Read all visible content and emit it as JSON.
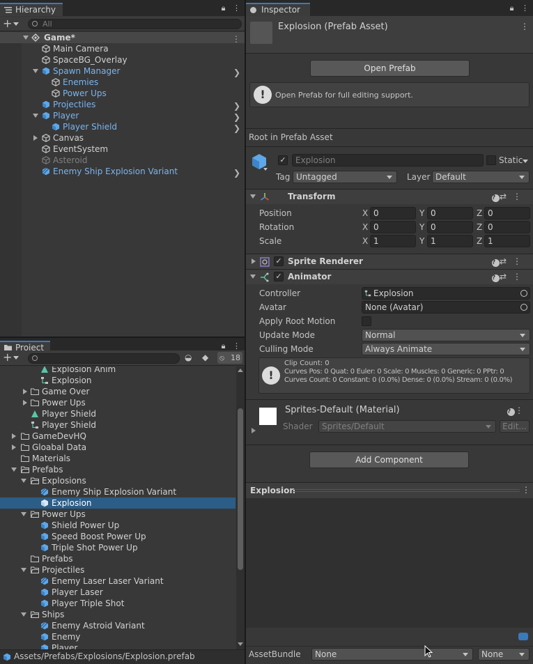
{
  "hierarchy": {
    "tab_label": "Hierarchy",
    "search_placeholder": "All",
    "scene_name": "Game*",
    "items": [
      {
        "label": "Main Camera"
      },
      {
        "label": "SpaceBG_Overlay"
      },
      {
        "label": "Spawn Manager"
      },
      {
        "label": "Enemies"
      },
      {
        "label": "Power Ups"
      },
      {
        "label": "Projectiles"
      },
      {
        "label": "Player"
      },
      {
        "label": "Player Shield"
      },
      {
        "label": "Canvas"
      },
      {
        "label": "EventSystem"
      },
      {
        "label": "Asteroid"
      },
      {
        "label": "Enemy Ship Explosion Variant"
      }
    ]
  },
  "project": {
    "tab_label": "Project",
    "hidden_count": "18",
    "items": [
      {
        "label": "Explosion Anim"
      },
      {
        "label": "Explosion"
      },
      {
        "label": "Game Over"
      },
      {
        "label": "Power Ups"
      },
      {
        "label": "Player Shield"
      },
      {
        "label": "Player Shield"
      },
      {
        "label": "GameDevHQ"
      },
      {
        "label": "Gloabal Data"
      },
      {
        "label": "Materials"
      },
      {
        "label": "Prefabs"
      },
      {
        "label": "Explosions"
      },
      {
        "label": "Enemy Ship Explosion Variant"
      },
      {
        "label": "Explosion"
      },
      {
        "label": "Power Ups"
      },
      {
        "label": "Shield Power Up"
      },
      {
        "label": "Speed Boost Power Up"
      },
      {
        "label": "Triple Shot Power Up"
      },
      {
        "label": "Prefabs"
      },
      {
        "label": "Projectiles"
      },
      {
        "label": "Enemy Laser Laser Variant"
      },
      {
        "label": "Player Laser"
      },
      {
        "label": "Player Triple Shot"
      },
      {
        "label": "Ships"
      },
      {
        "label": "Enemy Astroid Variant"
      },
      {
        "label": "Enemy"
      },
      {
        "label": "Player"
      }
    ],
    "status_path": "Assets/Prefabs/Explosions/Explosion.prefab"
  },
  "inspector": {
    "tab_label": "Inspector",
    "asset_title": "Explosion (Prefab Asset)",
    "open_prefab_label": "Open Prefab",
    "open_prefab_info": "Open Prefab for full editing support.",
    "root_label": "Root in Prefab Asset",
    "object_name": "Explosion",
    "static_label": "Static",
    "tag_label": "Tag",
    "tag_value": "Untagged",
    "layer_label": "Layer",
    "layer_value": "Default",
    "transform": {
      "title": "Transform",
      "rows": [
        {
          "label": "Position",
          "x": "0",
          "y": "0",
          "z": "0"
        },
        {
          "label": "Rotation",
          "x": "0",
          "y": "0",
          "z": "0"
        },
        {
          "label": "Scale",
          "x": "1",
          "y": "1",
          "z": "1"
        }
      ],
      "x_label": "X",
      "y_label": "Y",
      "z_label": "Z"
    },
    "sprite_renderer_title": "Sprite Renderer",
    "animator": {
      "title": "Animator",
      "controller_label": "Controller",
      "controller_value": "Explosion",
      "avatar_label": "Avatar",
      "avatar_value": "None (Avatar)",
      "apply_root_motion_label": "Apply Root Motion",
      "update_mode_label": "Update Mode",
      "update_mode_value": "Normal",
      "culling_mode_label": "Culling Mode",
      "culling_mode_value": "Always Animate",
      "info_line1": "Clip Count: 0",
      "info_line2": "Curves Pos: 0 Quat: 0 Euler: 0 Scale: 0 Muscles: 0 Generic: 0 PPtr: 0",
      "info_line3": "Curves Count: 0 Constant: 0 (0.0%) Dense: 0 (0.0%) Stream: 0 (0.0%)"
    },
    "material": {
      "title": "Sprites-Default (Material)",
      "shader_label": "Shader",
      "shader_value": "Sprites/Default",
      "edit_label": "Edit..."
    },
    "add_component_label": "Add Component",
    "preview_title": "Explosion",
    "assetbundle_label": "AssetBundle",
    "assetbundle_value": "None",
    "assetbundle_variant": "None"
  },
  "colors": {
    "selection": "#2c5d87",
    "prefab_blue": "#7ab4ef",
    "accent_tab": "#3a79bb"
  }
}
